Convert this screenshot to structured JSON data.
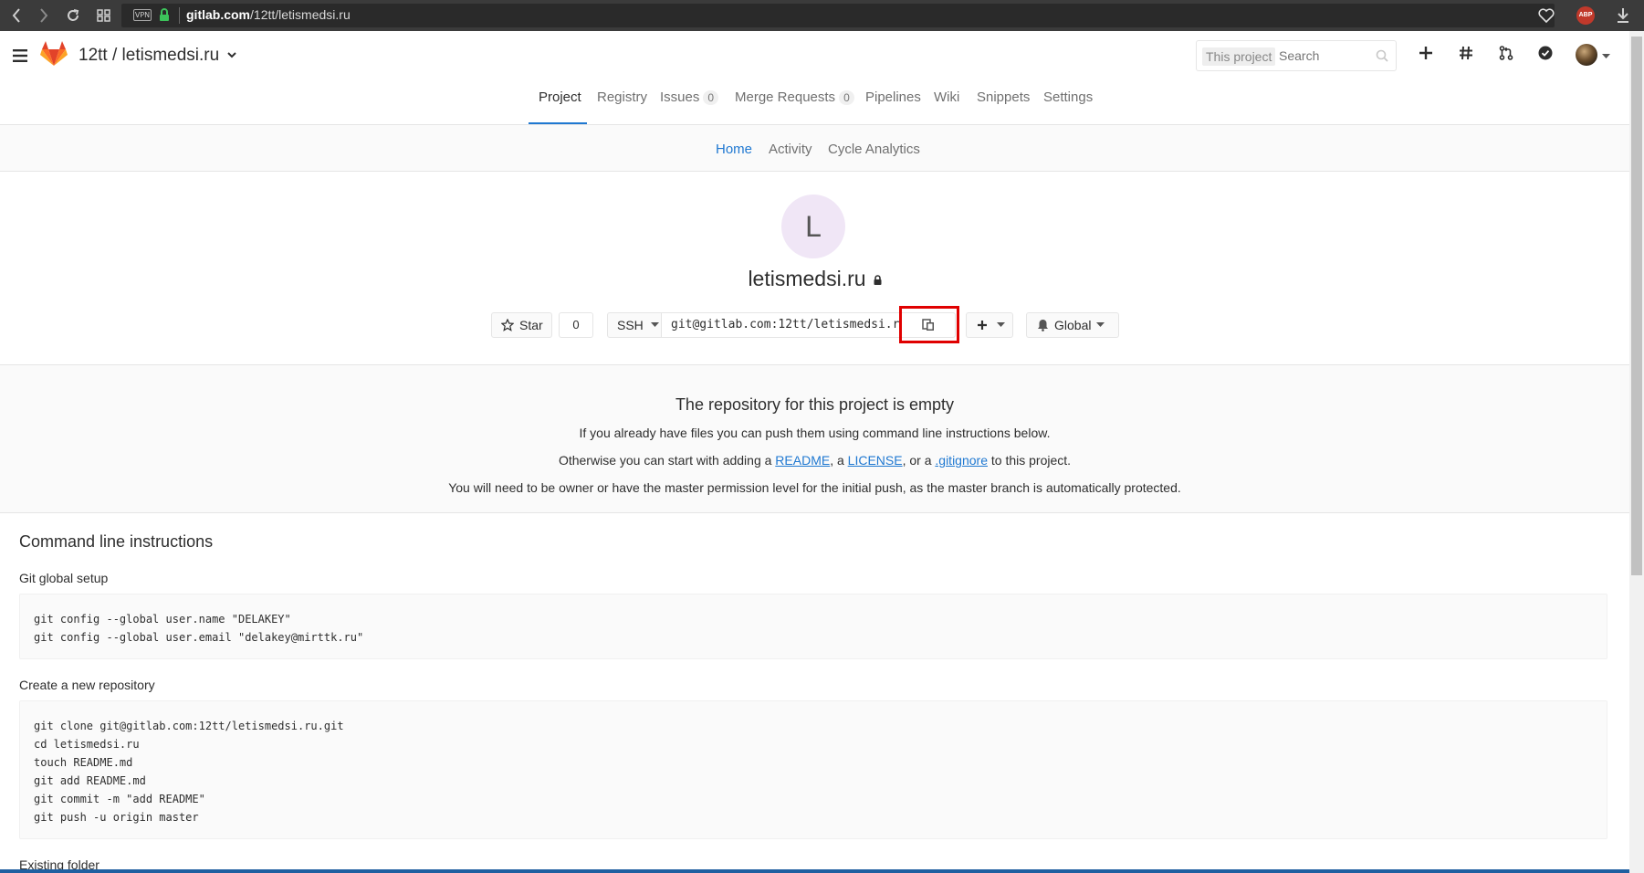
{
  "browser": {
    "url_host": "gitlab.com",
    "url_path": "/12tt/letismedsi.ru",
    "vpn_label": "VPN",
    "adblock_label": "ABP"
  },
  "header": {
    "project_path": "12tt / letismedsi.ru",
    "search_scope": "This project",
    "search_placeholder": "Search",
    "icons": [
      "plus-icon",
      "hash-icon",
      "merge-request-icon",
      "todo-check-icon",
      "user-avatar"
    ]
  },
  "nav": {
    "tabs": [
      {
        "label": "Project",
        "active": true
      },
      {
        "label": "Registry"
      },
      {
        "label": "Issues",
        "count": "0"
      },
      {
        "label": "Merge Requests",
        "count": "0"
      },
      {
        "label": "Pipelines"
      },
      {
        "label": "Wiki"
      },
      {
        "label": "Snippets"
      },
      {
        "label": "Settings"
      }
    ],
    "subtabs": [
      {
        "label": "Home",
        "active": true
      },
      {
        "label": "Activity"
      },
      {
        "label": "Cycle Analytics"
      }
    ]
  },
  "project": {
    "avatar_letter": "L",
    "name": "letismedsi.ru",
    "star_label": "Star",
    "star_count": "0",
    "protocol": "SSH",
    "clone_url": "git@gitlab.com:12tt/letismedsi.ru.git",
    "notification_level": "Global"
  },
  "empty_repo": {
    "title": "The repository for this project is empty",
    "line1": "If you already have files you can push them using command line instructions below.",
    "line2_prefix": "Otherwise you can start with adding a ",
    "readme_link": "README",
    "sep1": ", a ",
    "license_link": "LICENSE",
    "sep2": ", or a ",
    "gitignore_link": ".gitignore",
    "line2_suffix": " to this project.",
    "line3": "You will need to be owner or have the master permission level for the initial push, as the master branch is automatically protected."
  },
  "cli": {
    "title": "Command line instructions",
    "global_setup": {
      "title": "Git global setup",
      "lines": [
        "git config --global user.name \"DELAKEY\"",
        "git config --global user.email \"delakey@mirttk.ru\""
      ]
    },
    "new_repo": {
      "title": "Create a new repository",
      "lines": [
        "git clone git@gitlab.com:12tt/letismedsi.ru.git",
        "cd letismedsi.ru",
        "touch README.md",
        "git add README.md",
        "git commit -m \"add README\"",
        "git push -u origin master"
      ]
    },
    "existing_folder": {
      "title": "Existing folder"
    }
  },
  "colors": {
    "accent": "#1f78d1",
    "highlight": "#e00000",
    "browser_bar": "#3b3b3b"
  }
}
